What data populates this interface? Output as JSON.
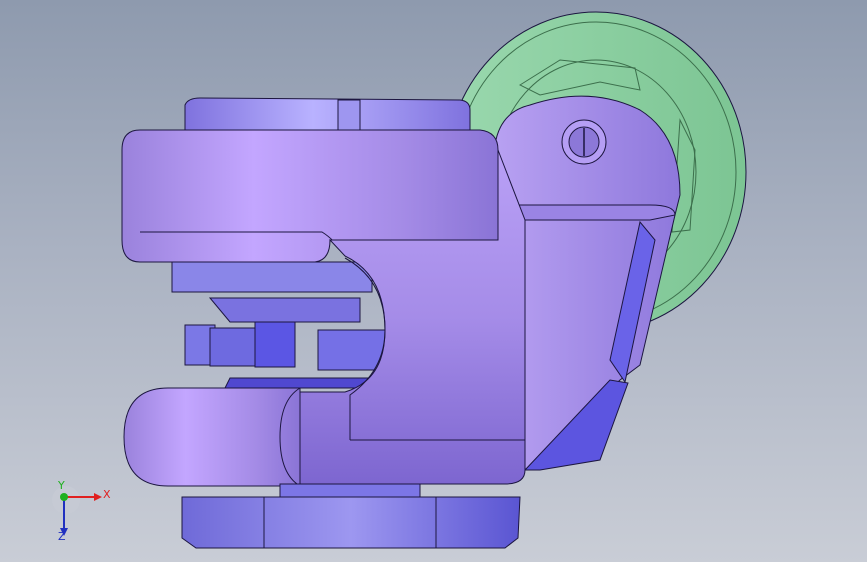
{
  "viewport": {
    "background_top": "#8e9aae",
    "background_bottom": "#c9cdd6"
  },
  "model": {
    "name_icon": "caster-wheel-assembly-icon",
    "colors": {
      "body_purple": "#a98fe6",
      "body_highlight": "#c4a8ff",
      "body_shadow": "#6f58c8",
      "blue_parts": "#6a63e8",
      "wheel_green": "#8fd3a6",
      "wheel_dark": "#5aa57a",
      "edge": "#1c1640"
    }
  },
  "triad": {
    "x_label": "X",
    "y_label": "Y",
    "z_label": "Z",
    "x_color": "#e02020",
    "y_color": "#20b020",
    "z_color": "#2030c0"
  }
}
